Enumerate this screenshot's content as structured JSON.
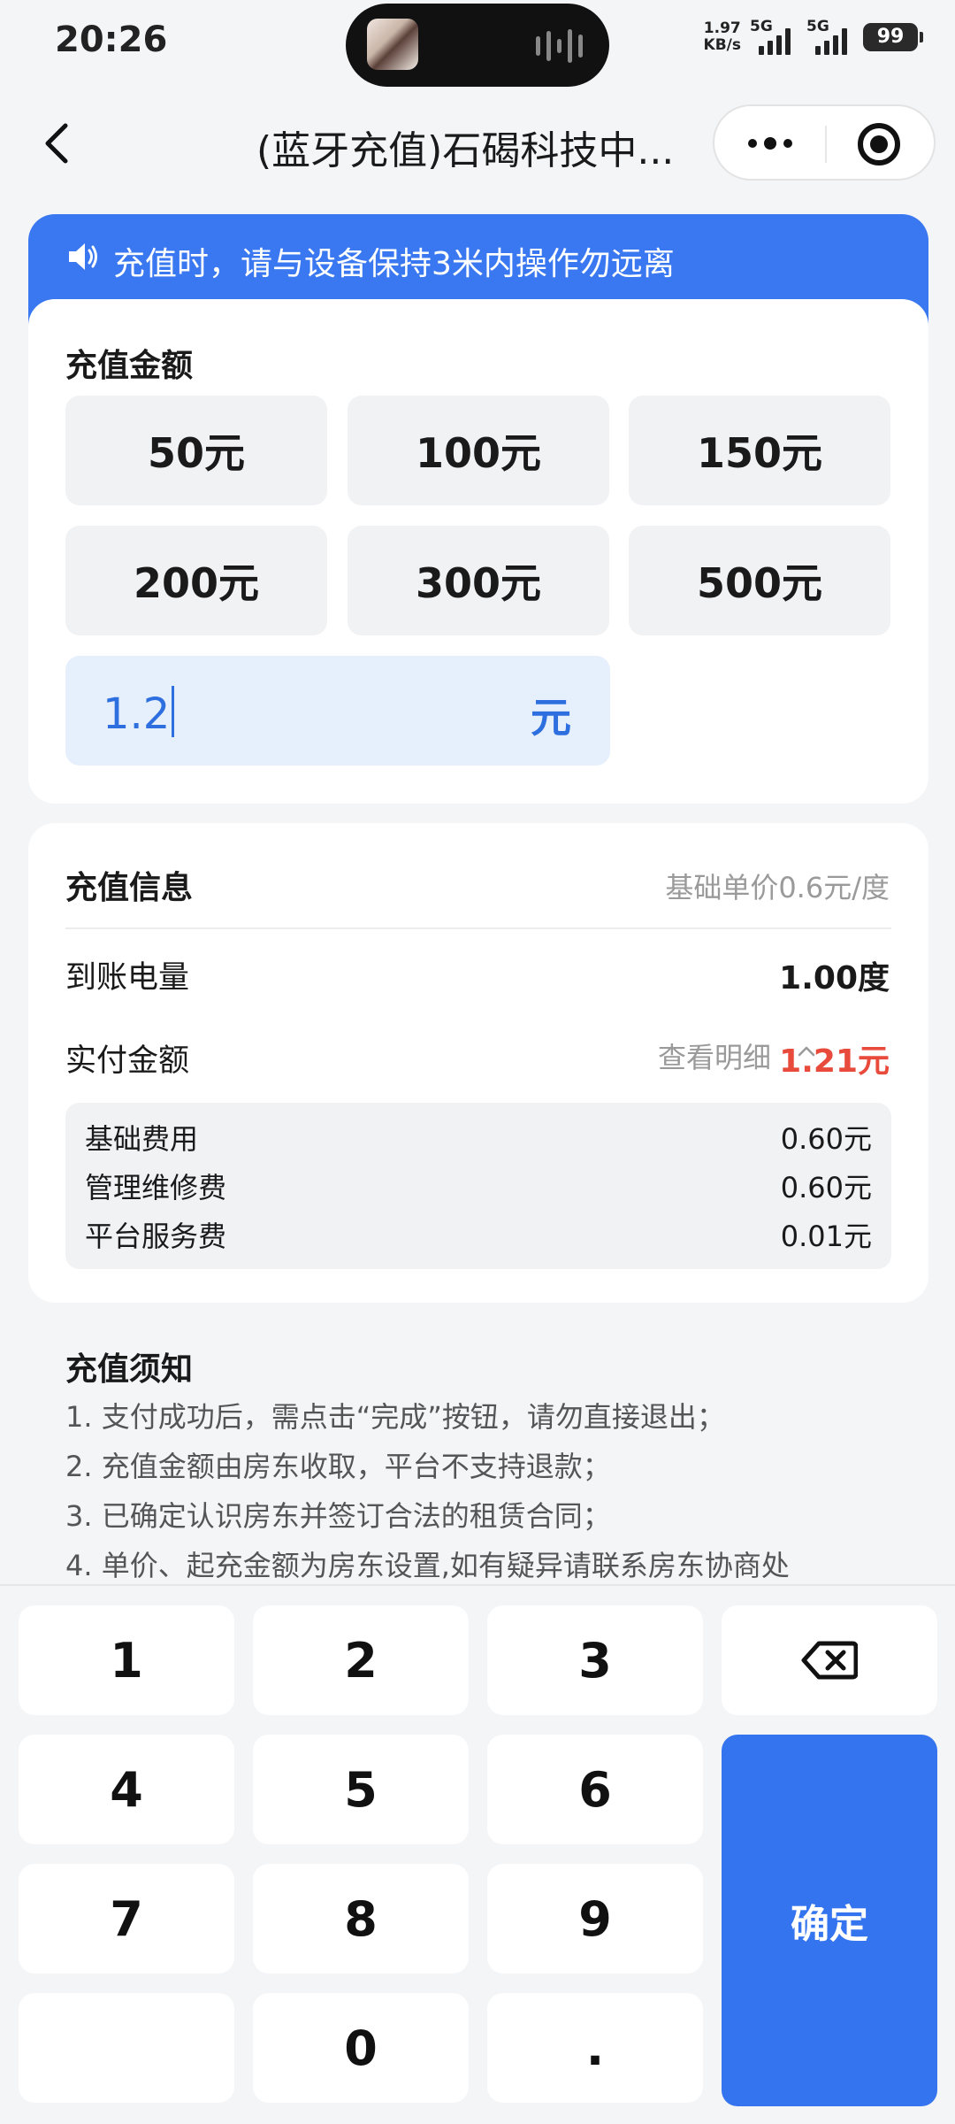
{
  "status_bar": {
    "time": "20:26",
    "net_speed_value": "1.97",
    "net_speed_unit": "KB/s",
    "signal_1": "5G",
    "signal_2": "5G",
    "battery": "99"
  },
  "nav": {
    "title": "(蓝牙充值)石碣科技中..."
  },
  "banner": {
    "text": "充值时，请与设备保持3米内操作勿远离",
    "icon": "speaker-icon",
    "color": "#3a78f2"
  },
  "amount": {
    "label": "充值金额",
    "options": [
      "50元",
      "100元",
      "150元",
      "200元",
      "300元",
      "500元"
    ],
    "custom_value": "1.2",
    "custom_unit": "元"
  },
  "info": {
    "title": "充值信息",
    "unit_price": "基础单价0.6元/度",
    "energy_label": "到账电量",
    "energy_value": "1.00度",
    "paid_label": "实付金额",
    "detail_link": "查看明细",
    "paid_value": "1.21元",
    "paid_color": "#e84a3c",
    "fees": [
      {
        "label": "基础费用",
        "value": "0.60元"
      },
      {
        "label": "管理维修费",
        "value": "0.60元"
      },
      {
        "label": "平台服务费",
        "value": "0.01元"
      }
    ]
  },
  "notes": {
    "title": "充值须知",
    "items": [
      "1. 支付成功后，需点击“完成”按钮，请勿直接退出；",
      "2. 充值金额由房东收取，平台不支持退款；",
      "3. 已确定认识房东并签订合法的租赁合同；",
      "4. 单价、起充金额为房东设置,如有疑异请联系房东协商处"
    ]
  },
  "keypad": {
    "keys": [
      "1",
      "2",
      "3",
      "4",
      "5",
      "6",
      "7",
      "8",
      "9",
      "0",
      "."
    ],
    "backspace_icon": "backspace-icon",
    "confirm": "确定",
    "confirm_color": "#3574ef"
  }
}
